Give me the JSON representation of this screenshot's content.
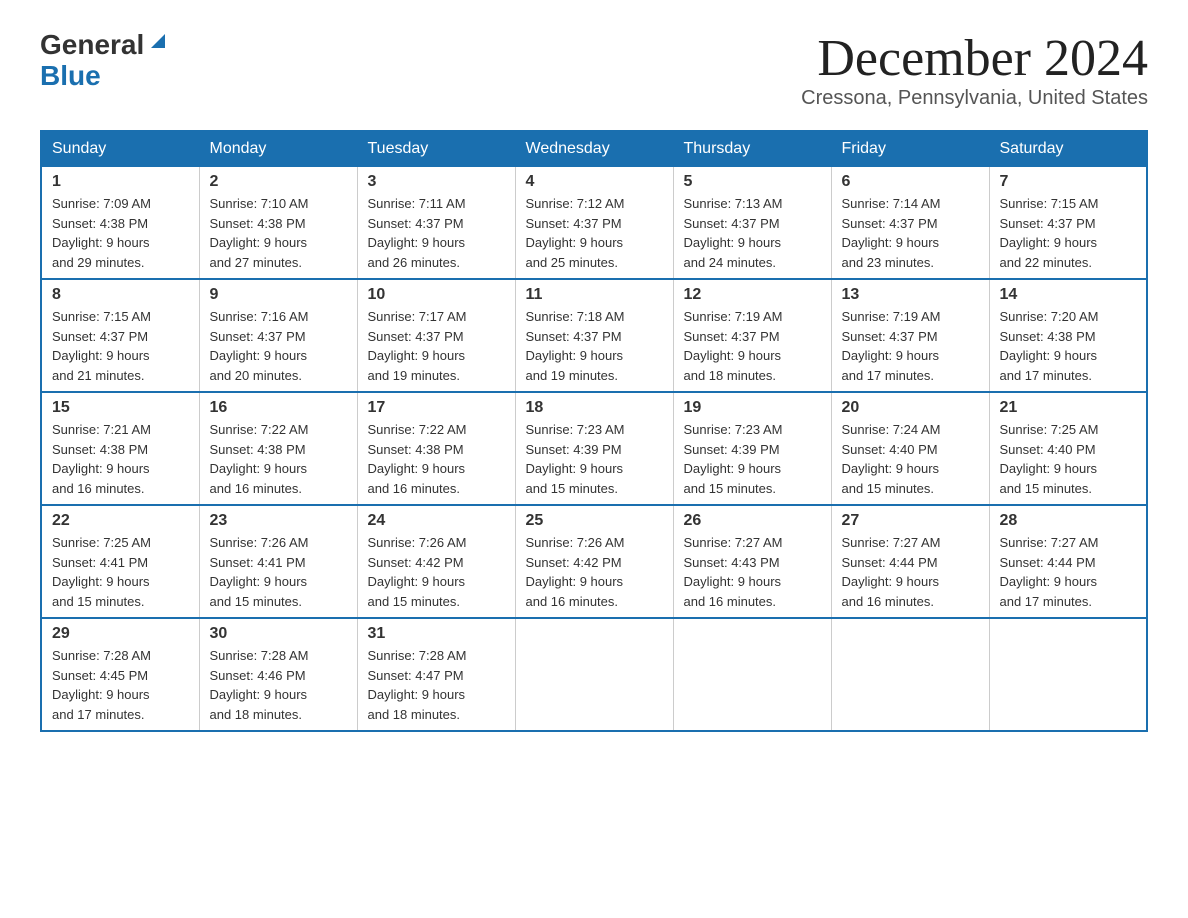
{
  "logo": {
    "general": "General",
    "blue": "Blue",
    "triangle_indicator": "▶"
  },
  "title": "December 2024",
  "location": "Cressona, Pennsylvania, United States",
  "days_of_week": [
    "Sunday",
    "Monday",
    "Tuesday",
    "Wednesday",
    "Thursday",
    "Friday",
    "Saturday"
  ],
  "weeks": [
    [
      {
        "day": "1",
        "sunrise": "7:09 AM",
        "sunset": "4:38 PM",
        "daylight": "9 hours and 29 minutes."
      },
      {
        "day": "2",
        "sunrise": "7:10 AM",
        "sunset": "4:38 PM",
        "daylight": "9 hours and 27 minutes."
      },
      {
        "day": "3",
        "sunrise": "7:11 AM",
        "sunset": "4:37 PM",
        "daylight": "9 hours and 26 minutes."
      },
      {
        "day": "4",
        "sunrise": "7:12 AM",
        "sunset": "4:37 PM",
        "daylight": "9 hours and 25 minutes."
      },
      {
        "day": "5",
        "sunrise": "7:13 AM",
        "sunset": "4:37 PM",
        "daylight": "9 hours and 24 minutes."
      },
      {
        "day": "6",
        "sunrise": "7:14 AM",
        "sunset": "4:37 PM",
        "daylight": "9 hours and 23 minutes."
      },
      {
        "day": "7",
        "sunrise": "7:15 AM",
        "sunset": "4:37 PM",
        "daylight": "9 hours and 22 minutes."
      }
    ],
    [
      {
        "day": "8",
        "sunrise": "7:15 AM",
        "sunset": "4:37 PM",
        "daylight": "9 hours and 21 minutes."
      },
      {
        "day": "9",
        "sunrise": "7:16 AM",
        "sunset": "4:37 PM",
        "daylight": "9 hours and 20 minutes."
      },
      {
        "day": "10",
        "sunrise": "7:17 AM",
        "sunset": "4:37 PM",
        "daylight": "9 hours and 19 minutes."
      },
      {
        "day": "11",
        "sunrise": "7:18 AM",
        "sunset": "4:37 PM",
        "daylight": "9 hours and 19 minutes."
      },
      {
        "day": "12",
        "sunrise": "7:19 AM",
        "sunset": "4:37 PM",
        "daylight": "9 hours and 18 minutes."
      },
      {
        "day": "13",
        "sunrise": "7:19 AM",
        "sunset": "4:37 PM",
        "daylight": "9 hours and 17 minutes."
      },
      {
        "day": "14",
        "sunrise": "7:20 AM",
        "sunset": "4:38 PM",
        "daylight": "9 hours and 17 minutes."
      }
    ],
    [
      {
        "day": "15",
        "sunrise": "7:21 AM",
        "sunset": "4:38 PM",
        "daylight": "9 hours and 16 minutes."
      },
      {
        "day": "16",
        "sunrise": "7:22 AM",
        "sunset": "4:38 PM",
        "daylight": "9 hours and 16 minutes."
      },
      {
        "day": "17",
        "sunrise": "7:22 AM",
        "sunset": "4:38 PM",
        "daylight": "9 hours and 16 minutes."
      },
      {
        "day": "18",
        "sunrise": "7:23 AM",
        "sunset": "4:39 PM",
        "daylight": "9 hours and 15 minutes."
      },
      {
        "day": "19",
        "sunrise": "7:23 AM",
        "sunset": "4:39 PM",
        "daylight": "9 hours and 15 minutes."
      },
      {
        "day": "20",
        "sunrise": "7:24 AM",
        "sunset": "4:40 PM",
        "daylight": "9 hours and 15 minutes."
      },
      {
        "day": "21",
        "sunrise": "7:25 AM",
        "sunset": "4:40 PM",
        "daylight": "9 hours and 15 minutes."
      }
    ],
    [
      {
        "day": "22",
        "sunrise": "7:25 AM",
        "sunset": "4:41 PM",
        "daylight": "9 hours and 15 minutes."
      },
      {
        "day": "23",
        "sunrise": "7:26 AM",
        "sunset": "4:41 PM",
        "daylight": "9 hours and 15 minutes."
      },
      {
        "day": "24",
        "sunrise": "7:26 AM",
        "sunset": "4:42 PM",
        "daylight": "9 hours and 15 minutes."
      },
      {
        "day": "25",
        "sunrise": "7:26 AM",
        "sunset": "4:42 PM",
        "daylight": "9 hours and 16 minutes."
      },
      {
        "day": "26",
        "sunrise": "7:27 AM",
        "sunset": "4:43 PM",
        "daylight": "9 hours and 16 minutes."
      },
      {
        "day": "27",
        "sunrise": "7:27 AM",
        "sunset": "4:44 PM",
        "daylight": "9 hours and 16 minutes."
      },
      {
        "day": "28",
        "sunrise": "7:27 AM",
        "sunset": "4:44 PM",
        "daylight": "9 hours and 17 minutes."
      }
    ],
    [
      {
        "day": "29",
        "sunrise": "7:28 AM",
        "sunset": "4:45 PM",
        "daylight": "9 hours and 17 minutes."
      },
      {
        "day": "30",
        "sunrise": "7:28 AM",
        "sunset": "4:46 PM",
        "daylight": "9 hours and 18 minutes."
      },
      {
        "day": "31",
        "sunrise": "7:28 AM",
        "sunset": "4:47 PM",
        "daylight": "9 hours and 18 minutes."
      },
      null,
      null,
      null,
      null
    ]
  ]
}
